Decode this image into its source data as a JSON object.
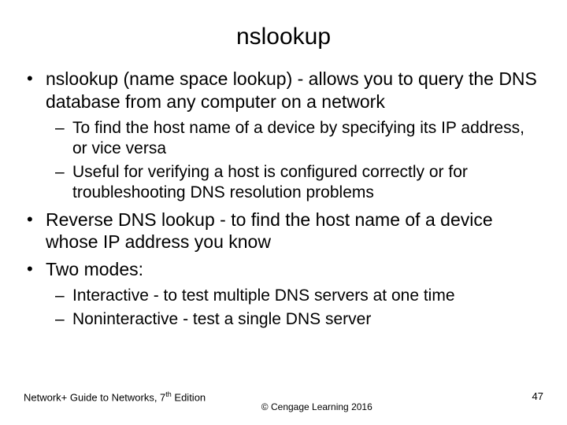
{
  "title": "nslookup",
  "bullets": {
    "b1": "nslookup (name space lookup) - allows you to query the DNS database from any computer on a network",
    "b1s1": "To find the host name of a device by specifying its IP address, or vice versa",
    "b1s2": "Useful for verifying a host is configured correctly or for troubleshooting DNS resolution problems",
    "b2": "Reverse DNS lookup - to find the host name of a device whose IP address you know",
    "b3": "Two modes:",
    "b3s1": "Interactive - to test multiple DNS servers at one time",
    "b3s2": "Noninteractive - test a single DNS server"
  },
  "footer": {
    "left_pre": "Network+ Guide to Networks, 7",
    "left_sup": "th",
    "left_post": " Edition",
    "center": "© Cengage Learning  2016",
    "page": "47"
  }
}
